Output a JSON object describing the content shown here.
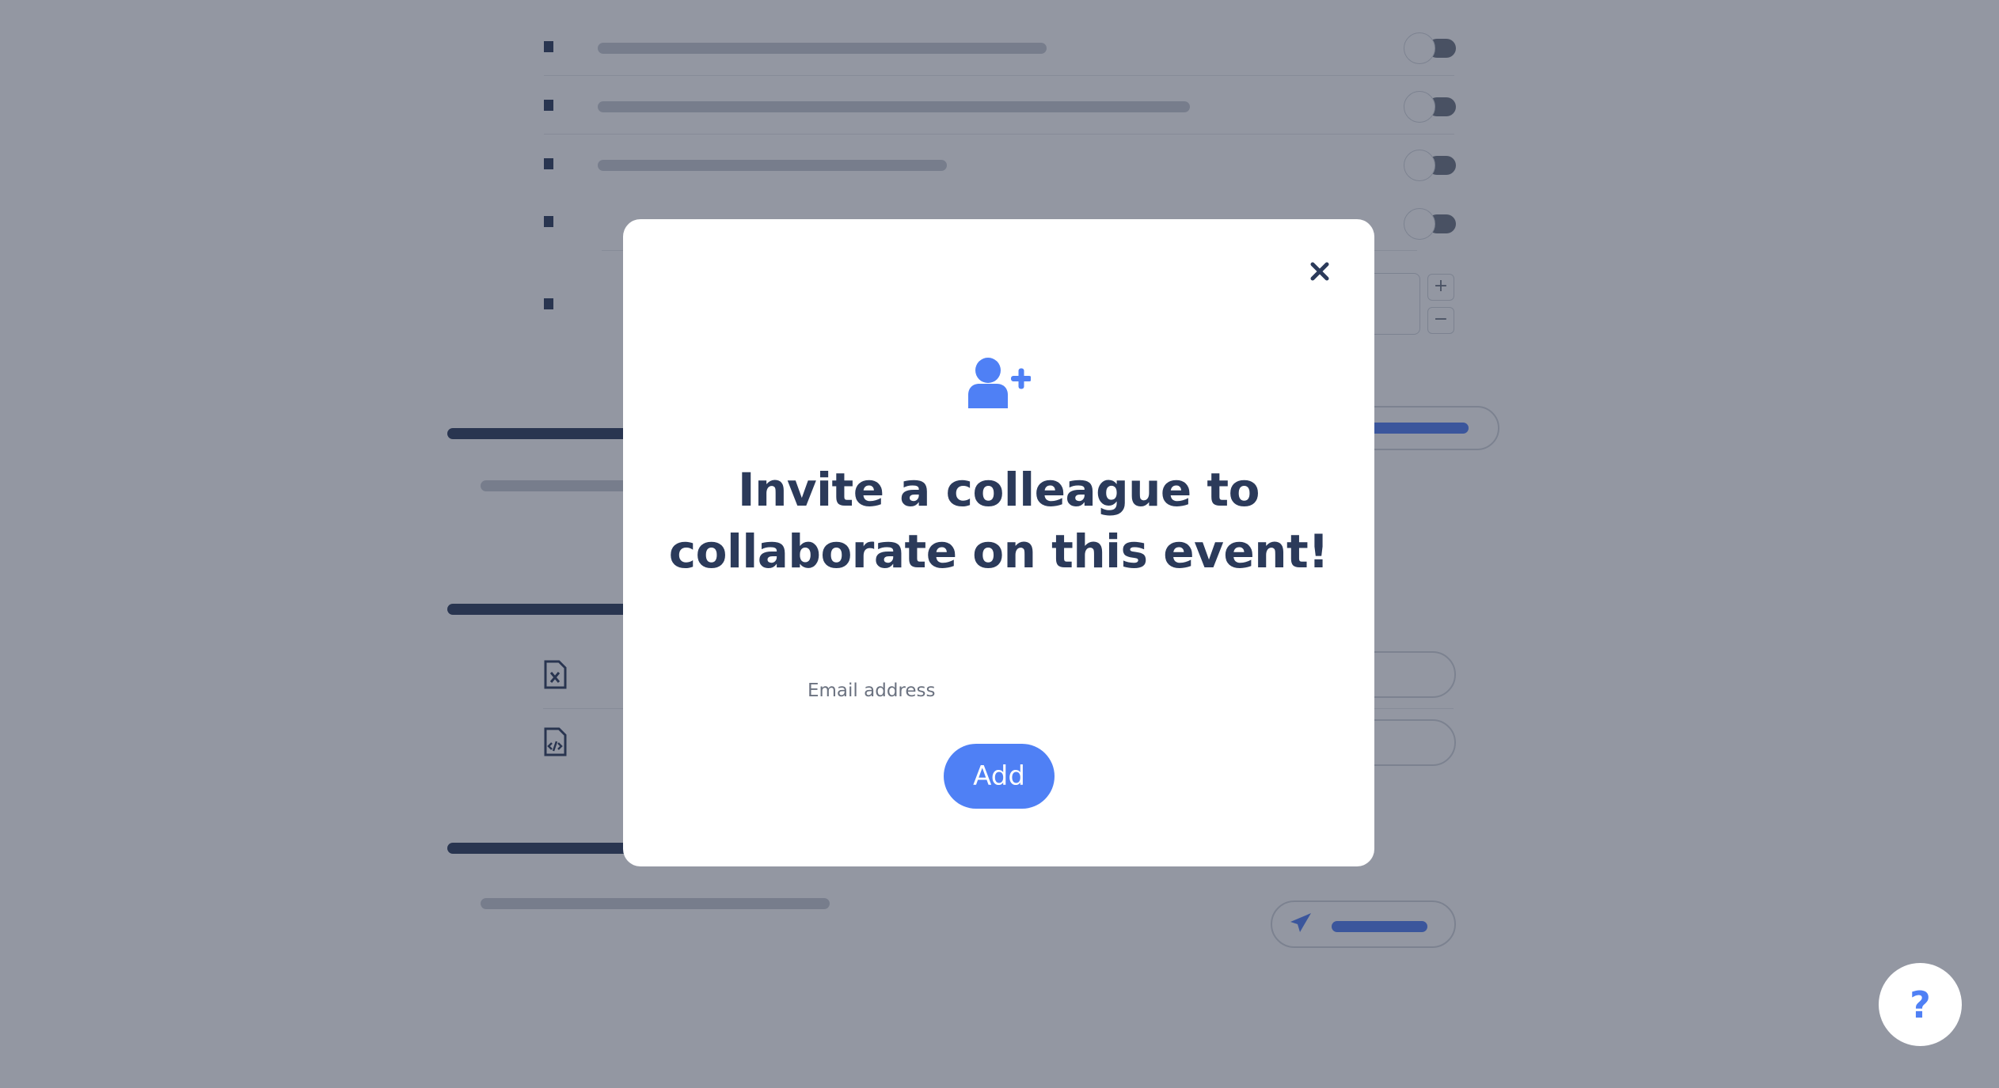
{
  "modal": {
    "title": "Invite a colleague to collaborate on this event!",
    "email_label": "Email address",
    "email_value": "",
    "email_placeholder": "",
    "add_label": "Add",
    "icons": {
      "header": "user-plus-icon",
      "close": "close-icon"
    }
  },
  "help": {
    "label": "?",
    "icon": "help-icon"
  },
  "colors": {
    "accent": "#4f80f5",
    "text_dark": "#2b3a5a",
    "label_gray": "#6b7280",
    "overlay": "#6b7280"
  },
  "background_page": {
    "settings_rows": [
      {
        "has_toggle": true,
        "toggle_on": false
      },
      {
        "has_toggle": true,
        "toggle_on": false
      },
      {
        "has_toggle": true,
        "toggle_on": false
      },
      {
        "has_toggle": true,
        "toggle_on": false
      },
      {
        "has_stepper": true,
        "stepper_plus": "+",
        "stepper_minus": "−"
      }
    ],
    "file_rows": [
      {
        "icon": "file-excel-icon"
      },
      {
        "icon": "file-code-icon"
      }
    ],
    "send_icon": "paper-plane-icon"
  }
}
